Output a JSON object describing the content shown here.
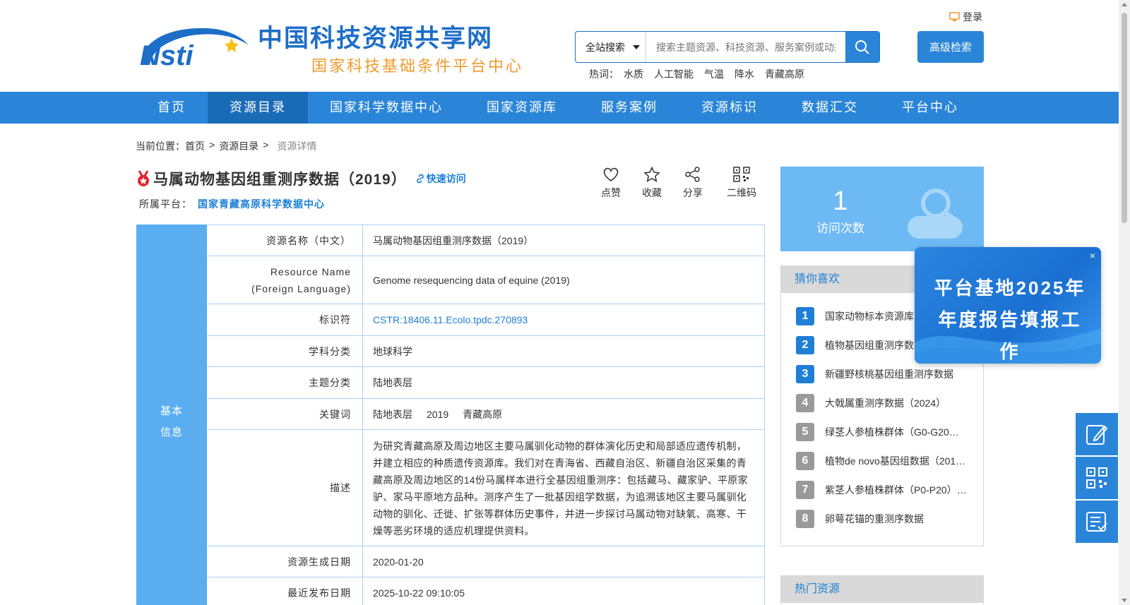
{
  "header": {
    "site_title": "中国科技资源共享网",
    "site_subtitle": "国家科技基础条件平台中心",
    "login_label": "登录",
    "search_scope": "全站搜索",
    "search_placeholder": "搜索主题资源、科技资源、服务案例或动态信息",
    "advanced_search_label": "高级检索",
    "hot_label": "热词：",
    "hot_words": [
      "水质",
      "人工智能",
      "气温",
      "降水",
      "青藏高原"
    ]
  },
  "nav": {
    "items": [
      "首页",
      "资源目录",
      "国家科学数据中心",
      "国家资源库",
      "服务案例",
      "资源标识",
      "数据汇交",
      "平台中心"
    ],
    "active": "资源目录"
  },
  "breadcrumb": {
    "prefix": "当前位置：",
    "items": [
      "首页",
      "资源目录",
      "资源详情"
    ],
    "sep": ">"
  },
  "resource": {
    "title": "马属动物基因组重测序数据（2019）",
    "quick_access_label": "快速访问",
    "platform_label": "所属平台：",
    "platform_value": "国家青藏高原科学数据中心",
    "actions": {
      "like": "点赞",
      "favorite": "收藏",
      "share": "分享",
      "qrcode": "二维码"
    }
  },
  "info": {
    "section_label_1": "基本",
    "section_label_2": "信息",
    "rows": [
      {
        "key": "资源名称（中文）",
        "value": "马属动物基因组重测序数据（2019）"
      },
      {
        "key_1": "Resource Name",
        "key_2": "(Foreign Language)",
        "value": "Genome resequencing data of equine (2019)"
      },
      {
        "key": "标识符",
        "value": "CSTR:18406.11.Ecolo.tpdc.270893"
      },
      {
        "key": "学科分类",
        "value": "地球科学"
      },
      {
        "key": "主题分类",
        "value": "陆地表层"
      },
      {
        "key": "关键词",
        "value_1": "陆地表层",
        "value_2": "2019",
        "value_3": "青藏高原"
      },
      {
        "key": "描述",
        "value": "为研究青藏高原及周边地区主要马属驯化动物的群体演化历史和局部适应遗传机制，并建立相应的种质遗传资源库。我们对在青海省、西藏自治区、新疆自治区采集的青藏高原及周边地区的14份马属样本进行全基因组重测序：包括藏马、藏家驴、平原家驴、家马平原地方品种。测序产生了一批基因组学数据，为追溯该地区主要马属驯化动物的驯化、迁徙、扩张等群体历史事件，并进一步探讨马属动物对缺氧、高寒、干燥等恶劣环境的适应机理提供资料。"
      },
      {
        "key": "资源生成日期",
        "value": "2020-01-20"
      },
      {
        "key": "最近发布日期",
        "value": "2025-10-22 09:10:05"
      }
    ]
  },
  "visits": {
    "count": "1",
    "label": "访问次数"
  },
  "recommend": {
    "title": "猜你喜欢",
    "items": [
      {
        "rank": "1",
        "text": "国家动物标本资源库"
      },
      {
        "rank": "2",
        "text": "植物基因组重测序数据"
      },
      {
        "rank": "3",
        "text": "新疆野核桃基因组重测序数据"
      },
      {
        "rank": "4",
        "text": "大戟属重测序数据（2024）"
      },
      {
        "rank": "5",
        "text": "绿茎人参植株群体（G0-G20…"
      },
      {
        "rank": "6",
        "text": "植物de novo基因组数据（201…"
      },
      {
        "rank": "7",
        "text": "紫茎人参植株群体（P0-P20）…"
      },
      {
        "rank": "8",
        "text": "卵萼花锚的重测序数据"
      }
    ]
  },
  "hot_resources": {
    "title": "热门资源"
  },
  "popup": {
    "text_1": "平台基地2025年",
    "text_2": "年度报告填报工作",
    "close": "×"
  },
  "colors": {
    "primary": "#2a85d8",
    "nav_active": "#1a6bb6",
    "accent_orange": "#ef9a2c",
    "link": "#1d80d6"
  }
}
